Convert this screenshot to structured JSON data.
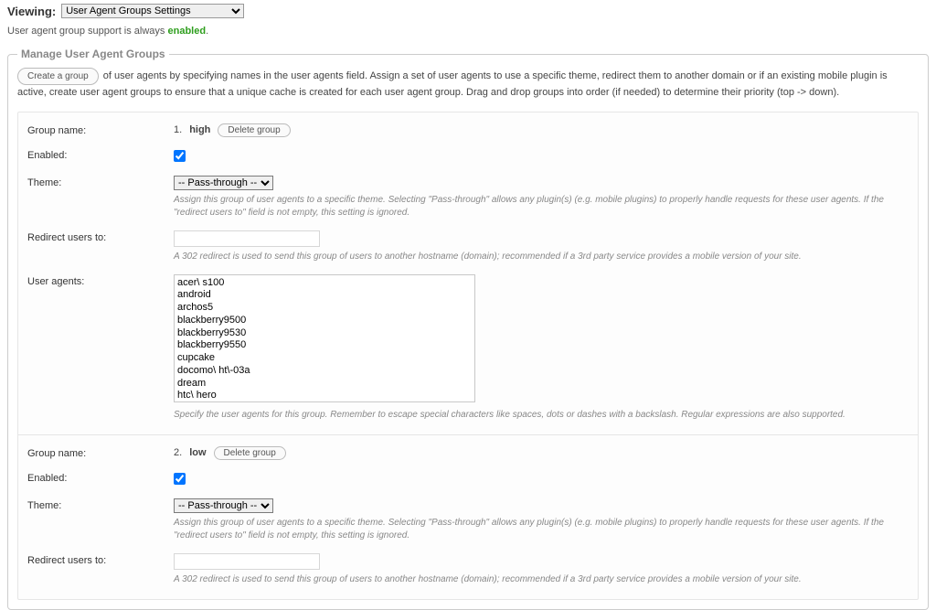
{
  "header": {
    "viewing_label": "Viewing:",
    "page_select": "User Agent Groups Settings"
  },
  "status": {
    "prefix": "User agent group support is always ",
    "state": "enabled",
    "suffix": "."
  },
  "panel": {
    "legend": "Manage User Agent Groups",
    "create_btn": "Create a group",
    "intro": " of user agents by specifying names in the user agents field. Assign a set of user agents to use a specific theme, redirect them to another domain or if an existing mobile plugin is active, create user agent groups to ensure that a unique cache is created for each user agent group. Drag and drop groups into order (if needed) to determine their priority (top -> down)."
  },
  "labels": {
    "group_name": "Group name:",
    "enabled": "Enabled:",
    "theme": "Theme:",
    "redirect": "Redirect users to:",
    "agents": "User agents:",
    "delete": "Delete group"
  },
  "help": {
    "theme": "Assign this group of user agents to a specific theme. Selecting \"Pass-through\" allows any plugin(s) (e.g. mobile plugins) to properly handle requests for these user agents. If the \"redirect users to\" field is not empty, this setting is ignored.",
    "redirect": "A 302 redirect is used to send this group of users to another hostname (domain); recommended if a 3rd party service provides a mobile version of your site.",
    "agents": "Specify the user agents for this group. Remember to escape special characters like spaces, dots or dashes with a backslash. Regular expressions are also supported."
  },
  "theme_option": "-- Pass-through --",
  "groups": [
    {
      "index": "1.",
      "name": "high",
      "enabled": true,
      "redirect": "",
      "agents": "acer\\ s100\nandroid\narchos5\nblackberry9500\nblackberry9530\nblackberry9550\ncupcake\ndocomo\\ ht\\-03a\ndream\nhtc\\ hero"
    },
    {
      "index": "2.",
      "name": "low",
      "enabled": true,
      "redirect": "",
      "agents": ""
    }
  ]
}
